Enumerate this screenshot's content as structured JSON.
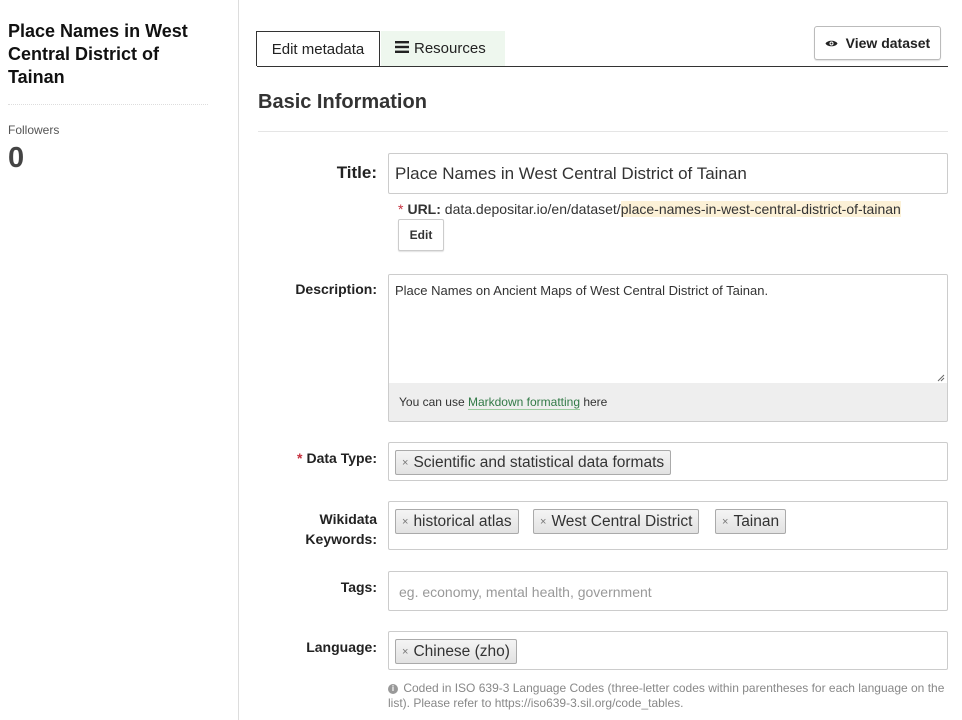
{
  "sidebar": {
    "title": "Place Names in West Central District of Tainan",
    "followers_label": "Followers",
    "followers_count": "0"
  },
  "tabs": {
    "edit_metadata": "Edit metadata",
    "resources": "Resources",
    "resources_icon": "list-icon"
  },
  "view_dataset": {
    "label": "View dataset",
    "icon": "eye-icon"
  },
  "section": {
    "heading": "Basic Information"
  },
  "form": {
    "title": {
      "label": "Title:",
      "value": "Place Names in West Central District of Tainan"
    },
    "url": {
      "label": "URL:",
      "base": "data.depositar.io/en/dataset/",
      "slug": "place-names-in-west-central-district-of-tainan",
      "edit_label": "Edit"
    },
    "description": {
      "label": "Description:",
      "value": "Place Names on Ancient Maps of West Central District of Tainan.",
      "help_prefix": "You can use ",
      "help_link": "Markdown formatting",
      "help_suffix": " here"
    },
    "data_type": {
      "label": "Data Type:",
      "required_marker": "*",
      "chips": [
        "Scientific and statistical data formats"
      ]
    },
    "wikidata_keywords": {
      "label_line1": "Wikidata",
      "label_line2": "Keywords:",
      "chips": [
        "historical atlas",
        "West Central District",
        "Tainan"
      ]
    },
    "tags": {
      "label": "Tags:",
      "placeholder": "eg. economy, mental health, government"
    },
    "language": {
      "label": "Language:",
      "chips": [
        "Chinese (zho)"
      ],
      "help": "Coded in ISO 639-3 Language Codes (three-letter codes within parentheses for each language on the list). Please refer to https://iso639-3.sil.org/code_tables."
    },
    "chip_remove_glyph": "×"
  },
  "colors": {
    "resources_tab_bg": "#eef7ee",
    "required": "#c6303e",
    "link": "#327a47",
    "url_slug_highlight": "#fcf1d7"
  }
}
